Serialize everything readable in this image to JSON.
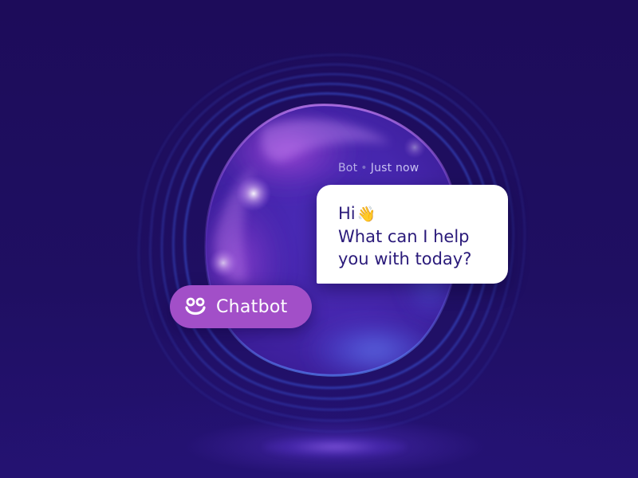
{
  "message": {
    "sender": "Bot",
    "separator": "•",
    "time": "Just now",
    "greeting": "Hi",
    "wave_emoji": "👋",
    "line2": "What can I help",
    "line3": "you with today?"
  },
  "badge": {
    "label": "Chatbot",
    "icon": "smiley-face-icon",
    "color": "#a24fc8"
  },
  "colors": {
    "background": "#1e0e5f",
    "bubble": "#ffffff",
    "text": "#2a1a7a",
    "accent": "#a24fc8"
  }
}
